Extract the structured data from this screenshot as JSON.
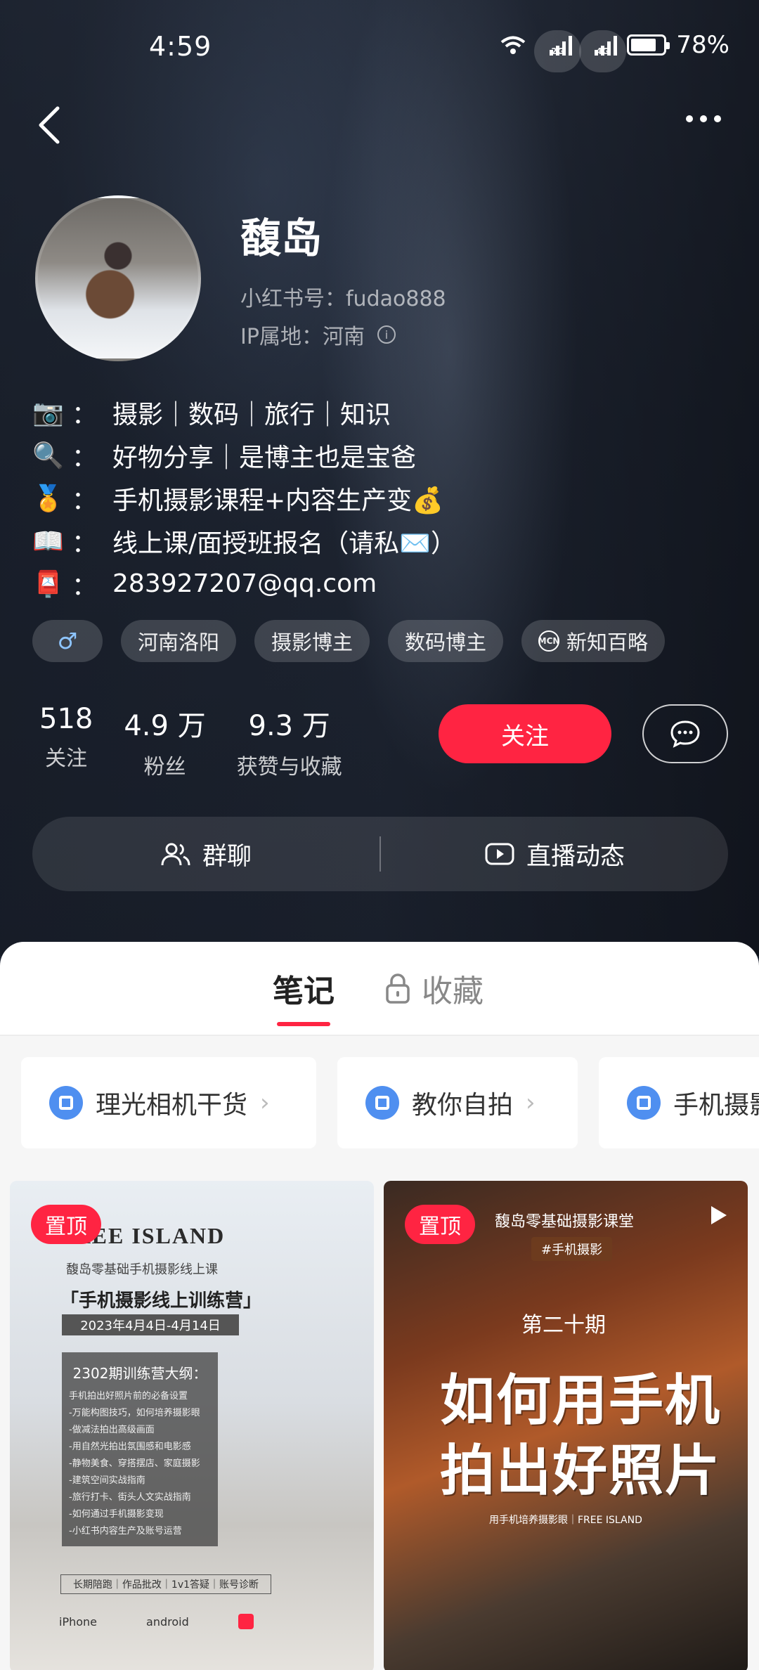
{
  "status_bar": {
    "time": "4:59",
    "network_1": "2G",
    "network_2": "4G",
    "battery": "78%"
  },
  "profile": {
    "name": "馥岛",
    "account_id": "小红书号：fudao888",
    "ip_location": "IP属地：河南",
    "bio": [
      {
        "icon": "📷",
        "text": "摄影｜数码｜旅行｜知识"
      },
      {
        "icon": "🔍",
        "text": "好物分享｜是博主也是宝爸"
      },
      {
        "icon": "🏅",
        "text": "手机摄影课程+内容生产变💰"
      },
      {
        "icon": "📖",
        "text": "线上课/面授班报名（请私✉️）"
      },
      {
        "icon": "📮",
        "text": "283927207@qq.com"
      }
    ],
    "tags": {
      "gender": "♂",
      "location": "河南洛阳",
      "tag1": "摄影博主",
      "tag2": "数码博主",
      "mcn": "新知百略"
    },
    "stats": [
      {
        "num": "518",
        "label": "关注"
      },
      {
        "num": "4.9 万",
        "label": "粉丝"
      },
      {
        "num": "9.3 万",
        "label": "获赞与收藏"
      }
    ],
    "follow_label": "关注",
    "group_chat_label": "群聊",
    "live_label": "直播动态"
  },
  "tabs": {
    "notes": "笔记",
    "favorites": "收藏"
  },
  "collections": [
    "理光相机干货",
    "教你自拍",
    "手机摄影"
  ],
  "cards": {
    "pin_label": "置顶",
    "card1": {
      "title": "FREE ISLAND",
      "subtitle": "馥岛零基础手机摄影线上课",
      "headline": "「手机摄影线上训练营」",
      "date": "2023年4月4日-4月14日",
      "box_title": "2302期训练营大纲：",
      "outline": [
        "手机拍出好照片前的必备设置",
        "-万能构图技巧，如何培养摄影眼",
        "-做减法拍出高级画面",
        "-用自然光拍出氛围感和电影感",
        "-静物美食、穿搭摆店、家庭摄影",
        "-建筑空间实战指南",
        "-旅行打卡、街头人文实战指南",
        "-如何通过手机摄影变现",
        "-小红书内容生产及账号运营"
      ],
      "footer": "长期陪跑｜作品批改｜1v1答疑｜账号诊断",
      "brand1": "iPhone",
      "brand2": "android"
    },
    "card2": {
      "top": "馥岛零基础摄影课堂",
      "tag": "#手机摄影",
      "period": "第二十期",
      "big1": "如何用手机",
      "big2": "拍出好照片",
      "small": "用手机培养摄影眼｜FREE ISLAND"
    }
  }
}
